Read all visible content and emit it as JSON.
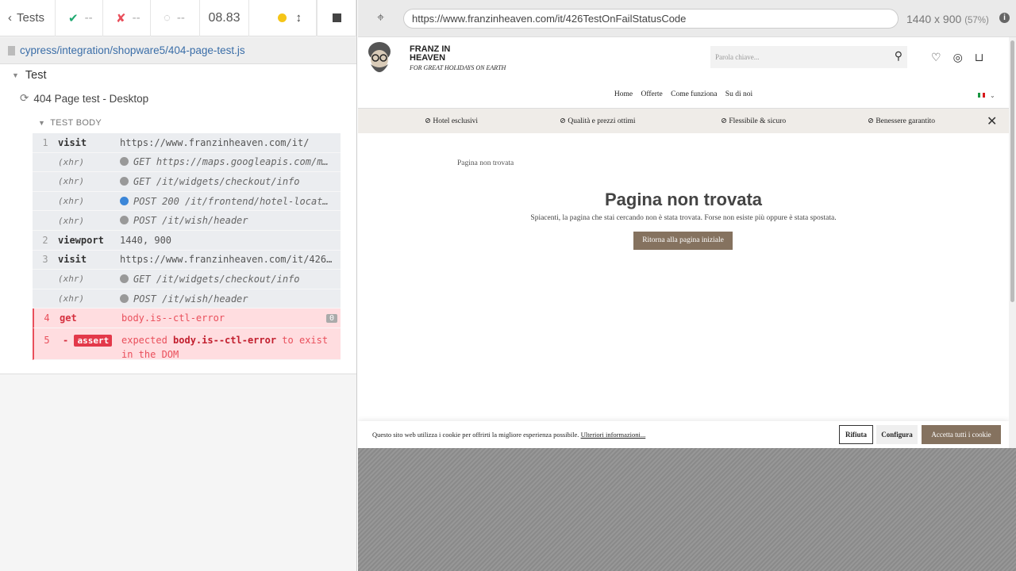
{
  "runner": {
    "tests_label": "Tests",
    "passed": "--",
    "failed": "--",
    "pending": "--",
    "timer": "08.83",
    "spec_path": "cypress/integration/shopware5/404-page-test.js",
    "suite": "Test",
    "test_title": "404 Page test - Desktop",
    "test_body_label": "TEST BODY",
    "commands": [
      {
        "num": "1",
        "name": "visit",
        "message": "https://www.franzinheaven.com/it/"
      },
      {
        "num": "",
        "name": "(xhr)",
        "message": "GET https://maps.googleapis.com/m…"
      },
      {
        "num": "",
        "name": "(xhr)",
        "message": "GET /it/widgets/checkout/info"
      },
      {
        "num": "",
        "name": "(xhr)",
        "message": "POST 200 /it/frontend/hotel-locat…"
      },
      {
        "num": "",
        "name": "(xhr)",
        "message": "POST /it/wish/header"
      },
      {
        "num": "2",
        "name": "viewport",
        "message": "1440, 900"
      },
      {
        "num": "3",
        "name": "visit",
        "message": "https://www.franzinheaven.com/it/426…"
      },
      {
        "num": "",
        "name": "(xhr)",
        "message": "GET /it/widgets/checkout/info"
      },
      {
        "num": "",
        "name": "(xhr)",
        "message": "POST /it/wish/header"
      }
    ],
    "error_cmd": {
      "num": "4",
      "name": "get",
      "message": "body.is--ctl-error",
      "badge": "0"
    },
    "assert_cmd": {
      "num": "5",
      "prefix": "-",
      "tag": "assert",
      "pre": "expected ",
      "bold": "body.is--ctl-error",
      "post": " to exist in the DOM"
    }
  },
  "aut_bar": {
    "url": "https://www.franzinheaven.com/it/426TestOnFailStatusCode",
    "size": "1440 x 900",
    "scale": "(57%)"
  },
  "site": {
    "brand_line1": "FRANZ IN",
    "brand_line2": "HEAVEN",
    "tagline": "FOR GREAT HOLIDAYS ON EARTH",
    "search_placeholder": "Parola chiave...",
    "nav": [
      "Home",
      "Offerte",
      "Come funziona",
      "Su di noi"
    ],
    "usps": [
      "Hotel esclusivi",
      "Qualità e prezzi ottimi",
      "Flessibile & sicuro",
      "Benessere garantito"
    ],
    "broken_img_alt": "Pagina non trovata",
    "heading": "Pagina non trovata",
    "subtext": "Spiacenti, la pagina che stai cercando non è stata trovata. Forse non esiste più oppure è stata spostata.",
    "home_button": "Ritorna alla pagina iniziale",
    "cookie_text": "Questo sito web utilizza i cookie per offrirti la migliore esperienza possibile.",
    "cookie_link": "Ulteriori informazioni...",
    "cookie_reject": "Rifiuta",
    "cookie_configure": "Configura",
    "cookie_accept": "Accetta tutti i cookie"
  },
  "colors": {
    "pass": "#1fa971",
    "fail": "#e94f5b",
    "brand_button": "#85725f",
    "running_dot": "#f5c518"
  }
}
